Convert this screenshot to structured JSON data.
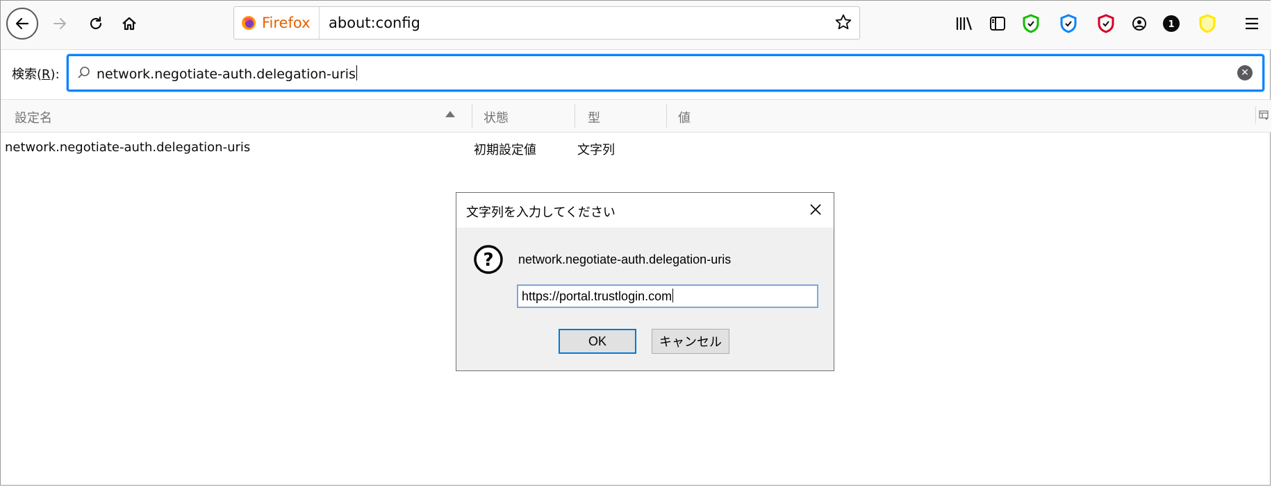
{
  "browser": {
    "identity_label": "Firefox",
    "url": "about:config",
    "accent": "#0a84ff"
  },
  "toolbar_icons": [
    "back-icon",
    "forward-icon",
    "reload-icon",
    "home-icon",
    "library-icon",
    "sidebar-icon",
    "shield-green-icon",
    "shield-blue-icon",
    "shield-red-icon",
    "account-icon",
    "badge-1-icon",
    "shield-yellow-icon",
    "menu-icon"
  ],
  "search": {
    "label_prefix": "検索(",
    "label_key": "R",
    "label_suffix": "):",
    "value": "network.negotiate-auth.delegation-uris"
  },
  "columns": {
    "name": "設定名",
    "status": "状態",
    "type": "型",
    "value": "値"
  },
  "rows": [
    {
      "name": "network.negotiate-auth.delegation-uris",
      "status": "初期設定値",
      "type": "文字列",
      "value": ""
    }
  ],
  "dialog": {
    "title": "文字列を入力してください",
    "message": "network.negotiate-auth.delegation-uris",
    "input_value": "https://portal.trustlogin.com",
    "ok_label": "OK",
    "cancel_label": "キャンセル"
  }
}
